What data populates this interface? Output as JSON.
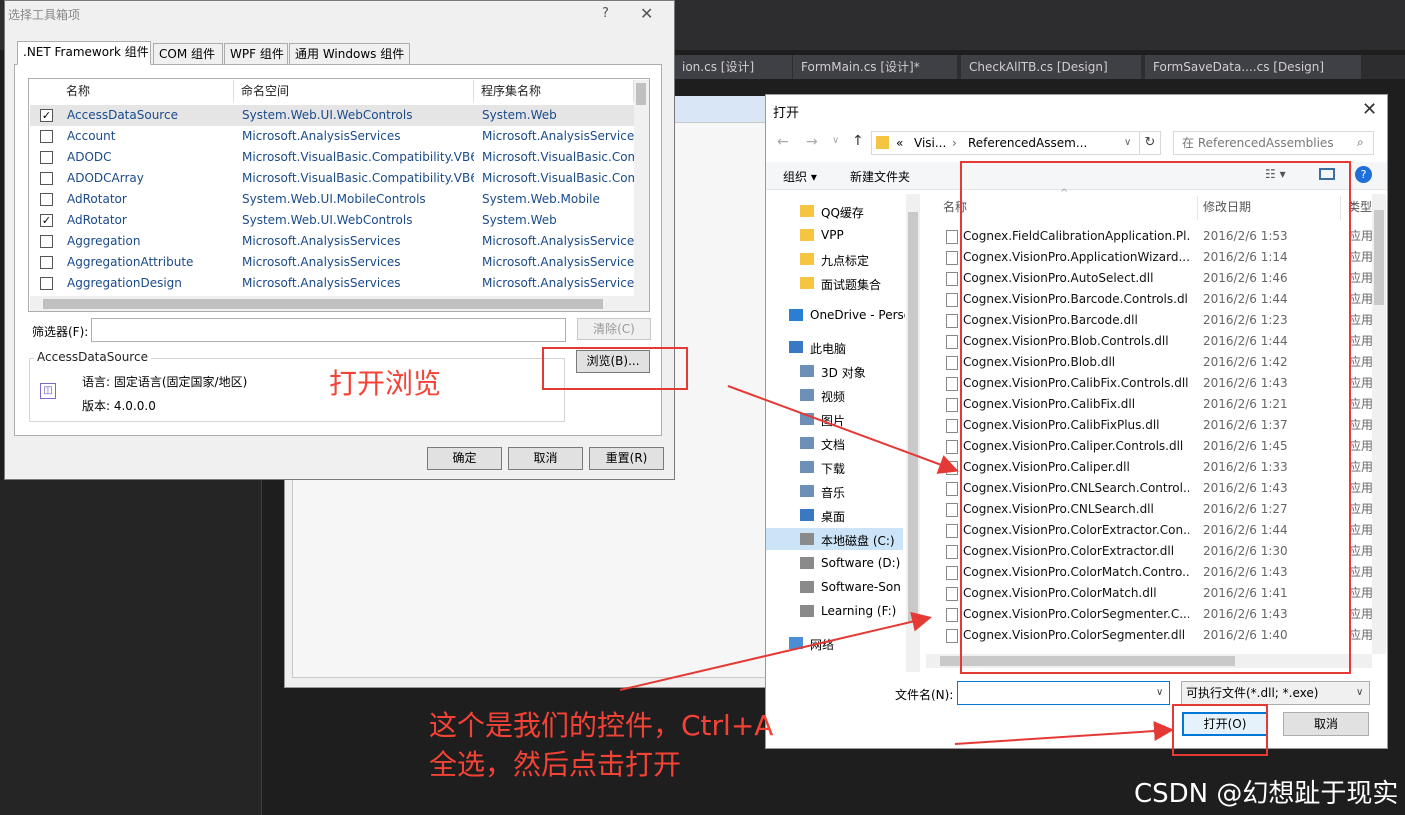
{
  "vs_tabs": [
    "ion.cs [设计]",
    "FormMain.cs [设计]*",
    "CheckAllTB.cs [Design]",
    "FormSaveData....cs [Design]"
  ],
  "toolbox": {
    "title": "选择工具箱项",
    "help": "?",
    "close": "✕",
    "tabs": [
      ".NET Framework 组件",
      "COM 组件",
      "WPF 组件",
      "通用 Windows 组件"
    ],
    "columns": [
      "名称",
      "命名空间",
      "程序集名称"
    ],
    "rows": [
      {
        "checked": true,
        "name": "AccessDataSource",
        "ns": "System.Web.UI.WebControls",
        "asm": "System.Web"
      },
      {
        "checked": false,
        "name": "Account",
        "ns": "Microsoft.AnalysisServices",
        "asm": "Microsoft.AnalysisServices"
      },
      {
        "checked": false,
        "name": "ADODC",
        "ns": "Microsoft.VisualBasic.Compatibility.VB6",
        "asm": "Microsoft.VisualBasic.Com"
      },
      {
        "checked": false,
        "name": "ADODCArray",
        "ns": "Microsoft.VisualBasic.Compatibility.VB6",
        "asm": "Microsoft.VisualBasic.Com"
      },
      {
        "checked": false,
        "name": "AdRotator",
        "ns": "System.Web.UI.MobileControls",
        "asm": "System.Web.Mobile"
      },
      {
        "checked": true,
        "name": "AdRotator",
        "ns": "System.Web.UI.WebControls",
        "asm": "System.Web"
      },
      {
        "checked": false,
        "name": "Aggregation",
        "ns": "Microsoft.AnalysisServices",
        "asm": "Microsoft.AnalysisServices"
      },
      {
        "checked": false,
        "name": "AggregationAttribute",
        "ns": "Microsoft.AnalysisServices",
        "asm": "Microsoft.AnalysisServices"
      },
      {
        "checked": false,
        "name": "AggregationDesign",
        "ns": "Microsoft.AnalysisServices",
        "asm": "Microsoft.AnalysisServices"
      }
    ],
    "filter_label": "筛选器(F):",
    "filter_value": "",
    "clear": "清除(C)",
    "info_title": "AccessDataSource",
    "info_lang": "语言: 固定语言(固定国家/地区)",
    "info_version": "版本: 4.0.0.0",
    "browse": "浏览(B)...",
    "ok": "确定",
    "cancel": "取消",
    "reset": "重置(R)"
  },
  "open_dialog": {
    "title": "打开",
    "close": "✕",
    "addr_prefix": "«",
    "addr_part1": "Visi...",
    "addr_part2": "ReferencedAssem...",
    "search_placeholder": "在 ReferencedAssemblies",
    "organize": "组织 ▾",
    "new_folder": "新建文件夹",
    "nav": [
      "QQ缓存",
      "VPP",
      "九点标定",
      "面试题集合",
      "OneDrive - Perso",
      "此电脑",
      "3D 对象",
      "视频",
      "图片",
      "文档",
      "下载",
      "音乐",
      "桌面",
      "本地磁盘 (C:)",
      "Software (D:)",
      "Software-Son (",
      "Learning (F:)",
      "网络"
    ],
    "col_name": "名称",
    "col_date": "修改日期",
    "col_type": "类型",
    "files": [
      {
        "name": "Cognex.FieldCalibrationApplication.Pl...",
        "date": "2016/2/6 1:53",
        "type": "应用"
      },
      {
        "name": "Cognex.VisionPro.ApplicationWizard....",
        "date": "2016/2/6 1:14",
        "type": "应用"
      },
      {
        "name": "Cognex.VisionPro.AutoSelect.dll",
        "date": "2016/2/6 1:46",
        "type": "应用"
      },
      {
        "name": "Cognex.VisionPro.Barcode.Controls.dll",
        "date": "2016/2/6 1:44",
        "type": "应用"
      },
      {
        "name": "Cognex.VisionPro.Barcode.dll",
        "date": "2016/2/6 1:23",
        "type": "应用"
      },
      {
        "name": "Cognex.VisionPro.Blob.Controls.dll",
        "date": "2016/2/6 1:44",
        "type": "应用"
      },
      {
        "name": "Cognex.VisionPro.Blob.dll",
        "date": "2016/2/6 1:42",
        "type": "应用"
      },
      {
        "name": "Cognex.VisionPro.CalibFix.Controls.dll",
        "date": "2016/2/6 1:43",
        "type": "应用"
      },
      {
        "name": "Cognex.VisionPro.CalibFix.dll",
        "date": "2016/2/6 1:21",
        "type": "应用"
      },
      {
        "name": "Cognex.VisionPro.CalibFixPlus.dll",
        "date": "2016/2/6 1:37",
        "type": "应用"
      },
      {
        "name": "Cognex.VisionPro.Caliper.Controls.dll",
        "date": "2016/2/6 1:45",
        "type": "应用"
      },
      {
        "name": "Cognex.VisionPro.Caliper.dll",
        "date": "2016/2/6 1:33",
        "type": "应用"
      },
      {
        "name": "Cognex.VisionPro.CNLSearch.Control...",
        "date": "2016/2/6 1:43",
        "type": "应用"
      },
      {
        "name": "Cognex.VisionPro.CNLSearch.dll",
        "date": "2016/2/6 1:27",
        "type": "应用"
      },
      {
        "name": "Cognex.VisionPro.ColorExtractor.Con...",
        "date": "2016/2/6 1:44",
        "type": "应用"
      },
      {
        "name": "Cognex.VisionPro.ColorExtractor.dll",
        "date": "2016/2/6 1:30",
        "type": "应用"
      },
      {
        "name": "Cognex.VisionPro.ColorMatch.Contro...",
        "date": "2016/2/6 1:43",
        "type": "应用"
      },
      {
        "name": "Cognex.VisionPro.ColorMatch.dll",
        "date": "2016/2/6 1:41",
        "type": "应用"
      },
      {
        "name": "Cognex.VisionPro.ColorSegmenter.C...",
        "date": "2016/2/6 1:43",
        "type": "应用"
      },
      {
        "name": "Cognex.VisionPro.ColorSegmenter.dll",
        "date": "2016/2/6 1:40",
        "type": "应用"
      }
    ],
    "filename_label": "文件名(N):",
    "filename_value": "",
    "filetype": "可执行文件(*.dll; *.exe)",
    "open": "打开(O)",
    "cancel": "取消"
  },
  "annotations": {
    "browse_note": "打开浏览",
    "select_note_line1": "这个是我们的控件，Ctrl+A",
    "select_note_line2": "全选，然后点击打开"
  },
  "watermark": "CSDN @幻想趾于现实",
  "colors": {
    "annotation_red": "#e53935",
    "accent_blue": "#0078d7"
  }
}
